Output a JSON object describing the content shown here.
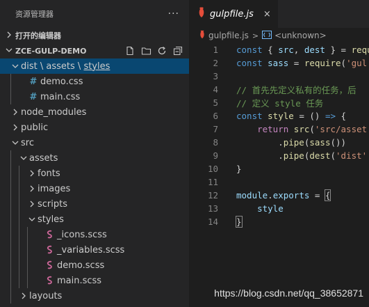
{
  "explorer": {
    "title": "资源管理器",
    "more": "···",
    "open_editors": "打开的编辑器",
    "project": "ZCE-GULP-DEMO",
    "tree": [
      {
        "kind": "folder",
        "open": true,
        "depth": 0,
        "label": "dist \\ assets \\ styles",
        "parts": [
          "dist",
          "assets",
          "styles"
        ],
        "selected": true
      },
      {
        "kind": "css",
        "depth": 1,
        "label": "demo.css"
      },
      {
        "kind": "css",
        "depth": 1,
        "label": "main.css"
      },
      {
        "kind": "folder",
        "open": false,
        "depth": 0,
        "label": "node_modules"
      },
      {
        "kind": "folder",
        "open": false,
        "depth": 0,
        "label": "public"
      },
      {
        "kind": "folder",
        "open": true,
        "depth": 0,
        "label": "src"
      },
      {
        "kind": "folder",
        "open": true,
        "depth": 1,
        "label": "assets"
      },
      {
        "kind": "folder",
        "open": false,
        "depth": 2,
        "label": "fonts"
      },
      {
        "kind": "folder",
        "open": false,
        "depth": 2,
        "label": "images"
      },
      {
        "kind": "folder",
        "open": false,
        "depth": 2,
        "label": "scripts"
      },
      {
        "kind": "folder",
        "open": true,
        "depth": 2,
        "label": "styles"
      },
      {
        "kind": "scss",
        "depth": 3,
        "label": "_icons.scss"
      },
      {
        "kind": "scss",
        "depth": 3,
        "label": "_variables.scss"
      },
      {
        "kind": "scss",
        "depth": 3,
        "label": "demo.scss"
      },
      {
        "kind": "scss",
        "depth": 3,
        "label": "main.scss"
      },
      {
        "kind": "folder",
        "open": false,
        "depth": 1,
        "label": "layouts"
      }
    ]
  },
  "editor": {
    "tab_label": "gulpfile.js",
    "tab_close": "×",
    "breadcrumb_file": "gulpfile.js",
    "breadcrumb_sep": ">",
    "breadcrumb_symbol": "<unknown>",
    "lines": [
      {
        "n": "1",
        "tokens": [
          [
            "kw",
            "const "
          ],
          [
            "pun",
            "{ "
          ],
          [
            "var",
            "src"
          ],
          [
            "pun",
            ", "
          ],
          [
            "var",
            "dest"
          ],
          [
            "pun",
            " } = "
          ],
          [
            "fn",
            "requ"
          ]
        ]
      },
      {
        "n": "2",
        "tokens": [
          [
            "kw",
            "const "
          ],
          [
            "var",
            "sass"
          ],
          [
            "pun",
            " = "
          ],
          [
            "fn",
            "require"
          ],
          [
            "pun",
            "("
          ],
          [
            "str",
            "'gul"
          ]
        ]
      },
      {
        "n": "3",
        "tokens": []
      },
      {
        "n": "4",
        "tokens": [
          [
            "cm",
            "// 首先先定义私有的任务，后"
          ]
        ]
      },
      {
        "n": "5",
        "tokens": [
          [
            "cm",
            "// 定义 style 任务"
          ]
        ]
      },
      {
        "n": "6",
        "tokens": [
          [
            "kw",
            "const "
          ],
          [
            "fn",
            "style"
          ],
          [
            "pun",
            " = () "
          ],
          [
            "kw",
            "=>"
          ],
          [
            "pun",
            " {"
          ]
        ]
      },
      {
        "n": "7",
        "tokens": [
          [
            "pun",
            "    "
          ],
          [
            "ctl",
            "return "
          ],
          [
            "fn",
            "src"
          ],
          [
            "pun",
            "("
          ],
          [
            "str",
            "'src/asset"
          ]
        ]
      },
      {
        "n": "8",
        "tokens": [
          [
            "pun",
            "        ."
          ],
          [
            "fn",
            "pipe"
          ],
          [
            "pun",
            "("
          ],
          [
            "fn",
            "sass"
          ],
          [
            "pun",
            "())"
          ]
        ]
      },
      {
        "n": "9",
        "tokens": [
          [
            "pun",
            "        ."
          ],
          [
            "fn",
            "pipe"
          ],
          [
            "pun",
            "("
          ],
          [
            "fn",
            "dest"
          ],
          [
            "pun",
            "("
          ],
          [
            "str",
            "'dist'"
          ]
        ]
      },
      {
        "n": "10",
        "tokens": [
          [
            "pun",
            "}"
          ]
        ]
      },
      {
        "n": "11",
        "tokens": []
      },
      {
        "n": "12",
        "tokens": [
          [
            "var",
            "module"
          ],
          [
            "pun",
            "."
          ],
          [
            "var",
            "exports"
          ],
          [
            "pun",
            " = "
          ],
          [
            "box",
            "{"
          ]
        ]
      },
      {
        "n": "13",
        "tokens": [
          [
            "pun",
            "    "
          ],
          [
            "var",
            "style"
          ]
        ]
      },
      {
        "n": "14",
        "tokens": [
          [
            "box",
            "}"
          ]
        ]
      }
    ]
  },
  "watermark": "https://blog.csdn.net/qq_38652871",
  "colors": {
    "accent": "#094771",
    "sass_icon": "#cd6799",
    "css_icon": "#519aba",
    "js_icon": "#e44d3a"
  }
}
